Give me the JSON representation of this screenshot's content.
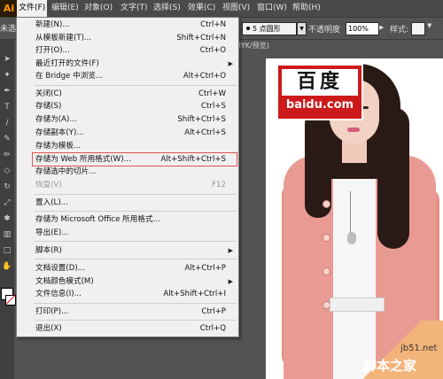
{
  "app": {
    "logo": "Ai"
  },
  "menubar": [
    {
      "id": "file",
      "label": "文件(F)"
    },
    {
      "id": "edit",
      "label": "编辑(E)"
    },
    {
      "id": "object",
      "label": "对象(O)"
    },
    {
      "id": "text",
      "label": "文字(T)"
    },
    {
      "id": "select",
      "label": "选择(S)"
    },
    {
      "id": "effect",
      "label": "效果(C)"
    },
    {
      "id": "view",
      "label": "视图(V)"
    },
    {
      "id": "window",
      "label": "窗口(W)"
    },
    {
      "id": "help",
      "label": "帮助(H)"
    }
  ],
  "optionsbar": {
    "selection_status": "未选",
    "stroke_value": "5 点圆形",
    "opacity_label": "不透明度",
    "opacity_value": "100%",
    "style_label": "样式:"
  },
  "document": {
    "tab_label": "MYK/预览)"
  },
  "file_menu": {
    "items": [
      {
        "label": "新建(N)...",
        "shortcut": "Ctrl+N"
      },
      {
        "label": "从模板新建(T)...",
        "shortcut": "Shift+Ctrl+N"
      },
      {
        "label": "打开(O)...",
        "shortcut": "Ctrl+O"
      },
      {
        "label": "最近打开的文件(F)",
        "shortcut": "",
        "submenu": true
      },
      {
        "label": "在 Bridge 中浏览...",
        "shortcut": "Alt+Ctrl+O"
      },
      {
        "label": "关闭(C)",
        "shortcut": "Ctrl+W"
      },
      {
        "label": "存储(S)",
        "shortcut": "Ctrl+S"
      },
      {
        "label": "存储为(A)...",
        "shortcut": "Shift+Ctrl+S"
      },
      {
        "label": "存储副本(Y)...",
        "shortcut": "Alt+Ctrl+S"
      },
      {
        "label": "存储为模板...",
        "shortcut": ""
      },
      {
        "label": "存储为 Web 所用格式(W)...",
        "shortcut": "Alt+Shift+Ctrl+S",
        "highlighted": true
      },
      {
        "label": "存储选中的切片...",
        "shortcut": ""
      },
      {
        "label": "恢复(V)",
        "shortcut": "F12",
        "disabled": true
      },
      {
        "label": "置入(L)...",
        "shortcut": ""
      },
      {
        "label": "存储为 Microsoft Office 所用格式...",
        "shortcut": ""
      },
      {
        "label": "导出(E)...",
        "shortcut": ""
      },
      {
        "label": "脚本(R)",
        "shortcut": "",
        "submenu": true
      },
      {
        "label": "文档设置(D)...",
        "shortcut": "Alt+Ctrl+P"
      },
      {
        "label": "文档颜色模式(M)",
        "shortcut": "",
        "submenu": true
      },
      {
        "label": "文件信息(I)...",
        "shortcut": "Alt+Shift+Ctrl+I"
      },
      {
        "label": "打印(P)...",
        "shortcut": "Ctrl+P"
      },
      {
        "label": "退出(X)",
        "shortcut": "Ctrl+Q"
      }
    ]
  },
  "watermark": {
    "logo_chars": "百度",
    "logo_domain": "baidu.com",
    "corner_site": "jb51.net",
    "corner_name": "脚本之家"
  },
  "colors": {
    "menu_bg": "#f0f0f0",
    "highlight_border": "#e05050",
    "logo_red": "#cc1a1a"
  }
}
